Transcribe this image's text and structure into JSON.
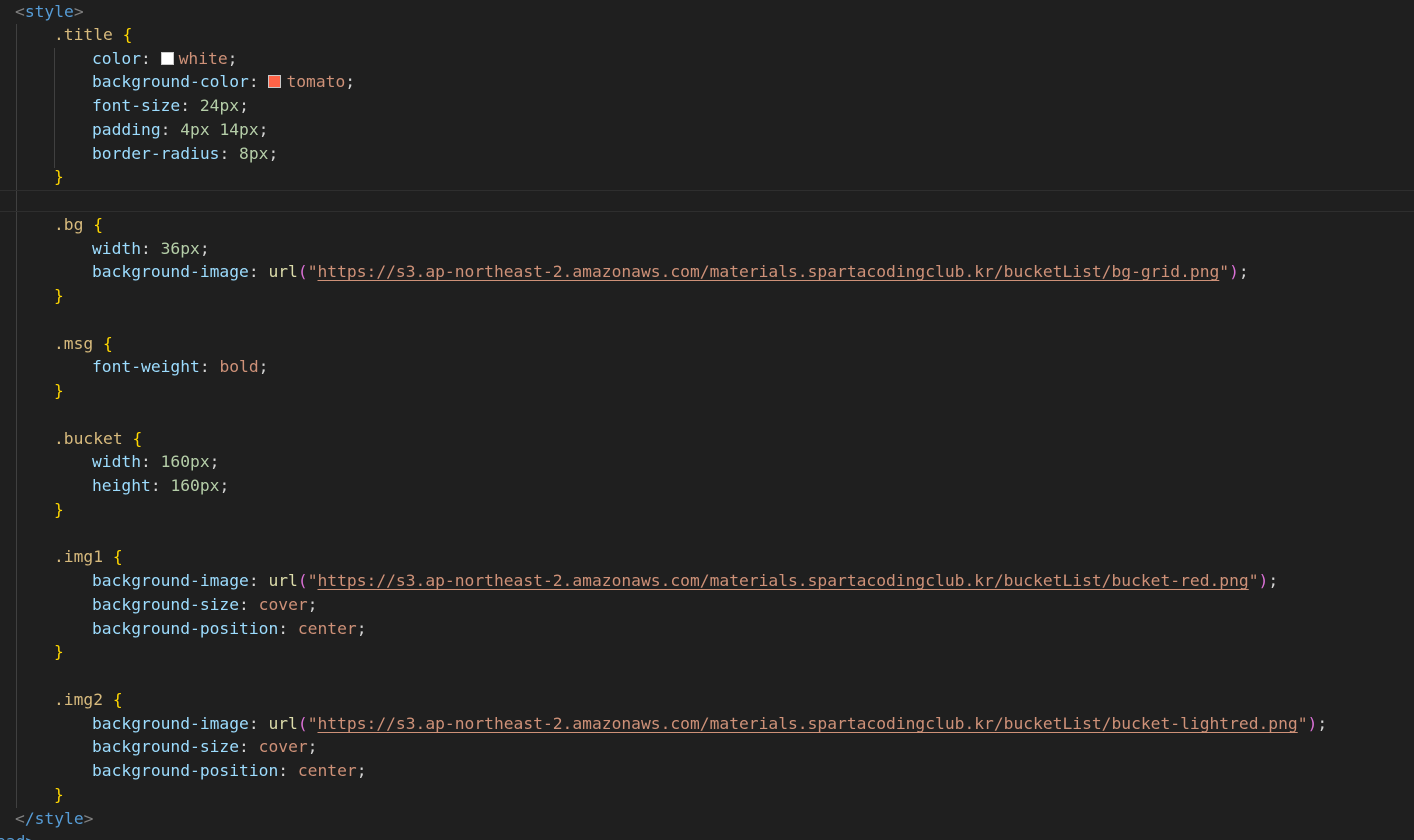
{
  "colors": {
    "background": "#1f1f1f",
    "white_swatch": "#ffffff",
    "tomato_swatch": "#ff6347"
  },
  "code": {
    "style_open": "style",
    "style_close": "/style",
    "partial_next_tag": "ead>",
    "title": {
      "selector": ".title",
      "color_prop": "color",
      "color_val": "white",
      "bg_prop": "background-color",
      "bg_val": "tomato",
      "fs_prop": "font-size",
      "fs_val": "24px",
      "pad_prop": "padding",
      "pad_val": "4px 14px",
      "br_prop": "border-radius",
      "br_val": "8px"
    },
    "bg": {
      "selector": ".bg",
      "w_prop": "width",
      "w_val": "36px",
      "bi_prop": "background-image",
      "bi_fn": "url",
      "bi_url": "https://s3.ap-northeast-2.amazonaws.com/materials.spartacodingclub.kr/bucketList/bg-grid.png"
    },
    "msg": {
      "selector": ".msg",
      "fw_prop": "font-weight",
      "fw_val": "bold"
    },
    "bucket": {
      "selector": ".bucket",
      "w_prop": "width",
      "w_val": "160px",
      "h_prop": "height",
      "h_val": "160px"
    },
    "img1": {
      "selector": ".img1",
      "bi_prop": "background-image",
      "bi_fn": "url",
      "bi_url": "https://s3.ap-northeast-2.amazonaws.com/materials.spartacodingclub.kr/bucketList/bucket-red.png",
      "bs_prop": "background-size",
      "bs_val": "cover",
      "bp_prop": "background-position",
      "bp_val": "center"
    },
    "img2": {
      "selector": ".img2",
      "bi_prop": "background-image",
      "bi_fn": "url",
      "bi_url": "https://s3.ap-northeast-2.amazonaws.com/materials.spartacodingclub.kr/bucketList/bucket-lightred.png",
      "bs_prop": "background-size",
      "bs_val": "cover",
      "bp_prop": "background-position",
      "bp_val": "center"
    }
  }
}
